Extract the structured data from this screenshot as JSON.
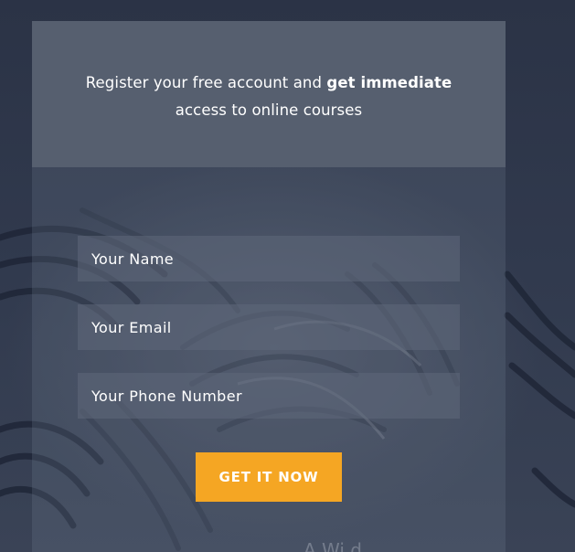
{
  "form": {
    "headline_prefix": "Register your free account and ",
    "headline_bold": "get immediate",
    "headline_suffix": "access to online courses",
    "fields": [
      {
        "placeholder": "Your Name"
      },
      {
        "placeholder": "Your Email"
      },
      {
        "placeholder": "Your Phone Number"
      }
    ],
    "submit_label": "GET IT NOW"
  },
  "background": {
    "image": "striped-fabric",
    "overlay_color": "#2c3447",
    "watermark_text": "A          Wi d"
  },
  "colors": {
    "accent": "#f5a623",
    "panel_top": "#565f6f",
    "text": "#ffffff"
  }
}
